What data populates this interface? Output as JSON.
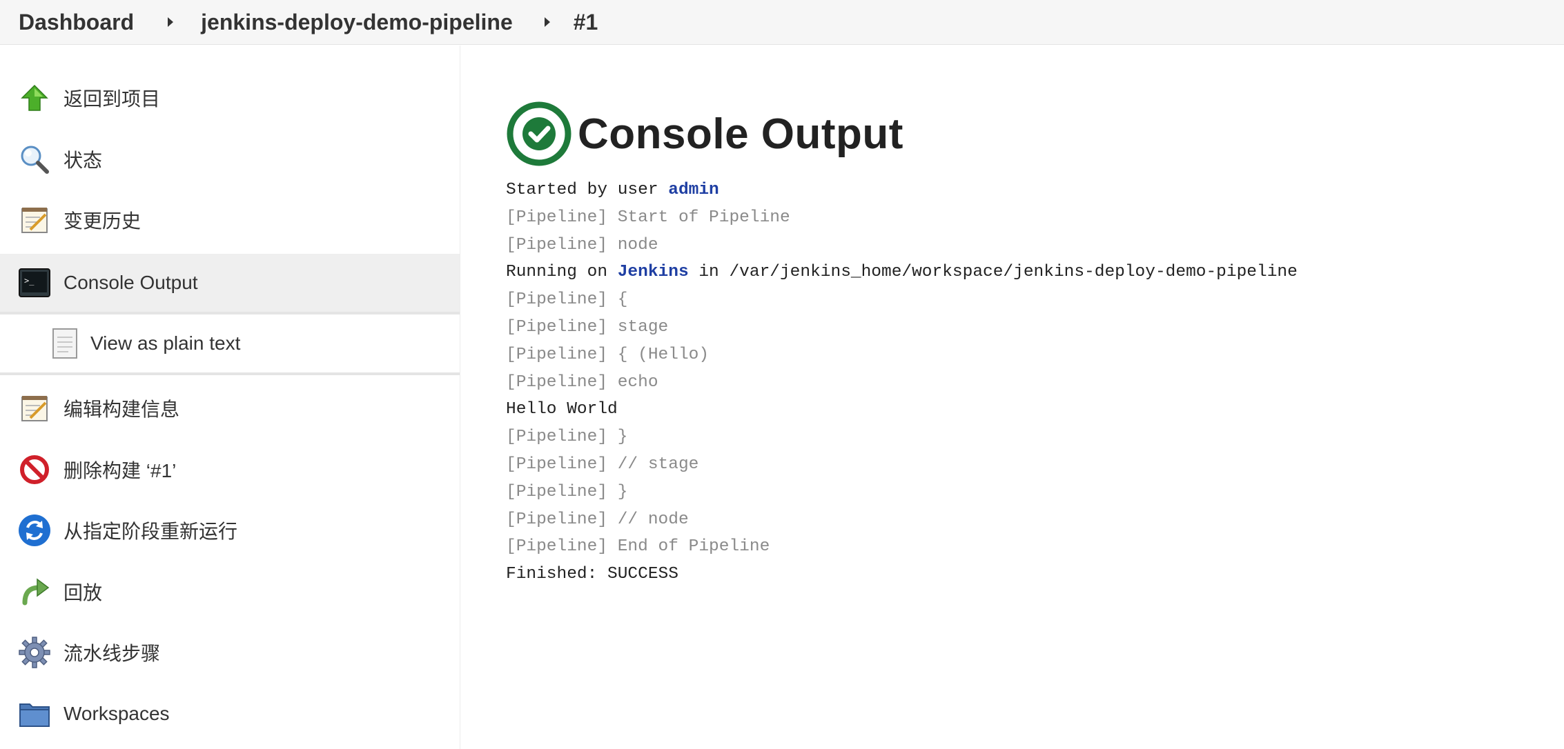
{
  "breadcrumb": {
    "items": [
      "Dashboard",
      "jenkins-deploy-demo-pipeline",
      "#1"
    ]
  },
  "sidebar": {
    "items": [
      {
        "label": "返回到项目",
        "icon": "up-arrow-icon"
      },
      {
        "label": "状态",
        "icon": "magnifier-icon"
      },
      {
        "label": "变更历史",
        "icon": "notepad-icon"
      },
      {
        "label": "Console Output",
        "icon": "terminal-icon",
        "active": true
      },
      {
        "label": "View as plain text",
        "icon": "document-icon",
        "sub": true
      },
      {
        "label": "编辑构建信息",
        "icon": "notepad-icon"
      },
      {
        "label": "删除构建 ‘#1’",
        "icon": "no-entry-icon"
      },
      {
        "label": "从指定阶段重新运行",
        "icon": "refresh-icon"
      },
      {
        "label": "回放",
        "icon": "replay-arrow-icon"
      },
      {
        "label": "流水线步骤",
        "icon": "gear-icon"
      },
      {
        "label": "Workspaces",
        "icon": "folder-icon"
      }
    ]
  },
  "main": {
    "title": "Console Output",
    "status_icon": "success-check-icon",
    "status_color": "#1e7a3a",
    "console": {
      "started_prefix": "Started by user ",
      "started_user": "admin",
      "pipeline_tag": "[Pipeline]",
      "lines_1": [
        " Start of Pipeline",
        " node"
      ],
      "running_prefix": "Running on ",
      "running_node": "Jenkins",
      "running_suffix": " in /var/jenkins_home/workspace/jenkins-deploy-demo-pipeline",
      "lines_2": [
        " {",
        " stage",
        " { (Hello)",
        " echo"
      ],
      "hello_output": "Hello World",
      "lines_3": [
        " }",
        " // stage",
        " }",
        " // node",
        " End of Pipeline"
      ],
      "finished": "Finished: SUCCESS"
    }
  },
  "colors": {
    "link": "#1f3fa3",
    "pipeline_gray": "#8a8a8a",
    "breadcrumb_bg": "#f6f6f6",
    "active_bg": "#efefef"
  }
}
